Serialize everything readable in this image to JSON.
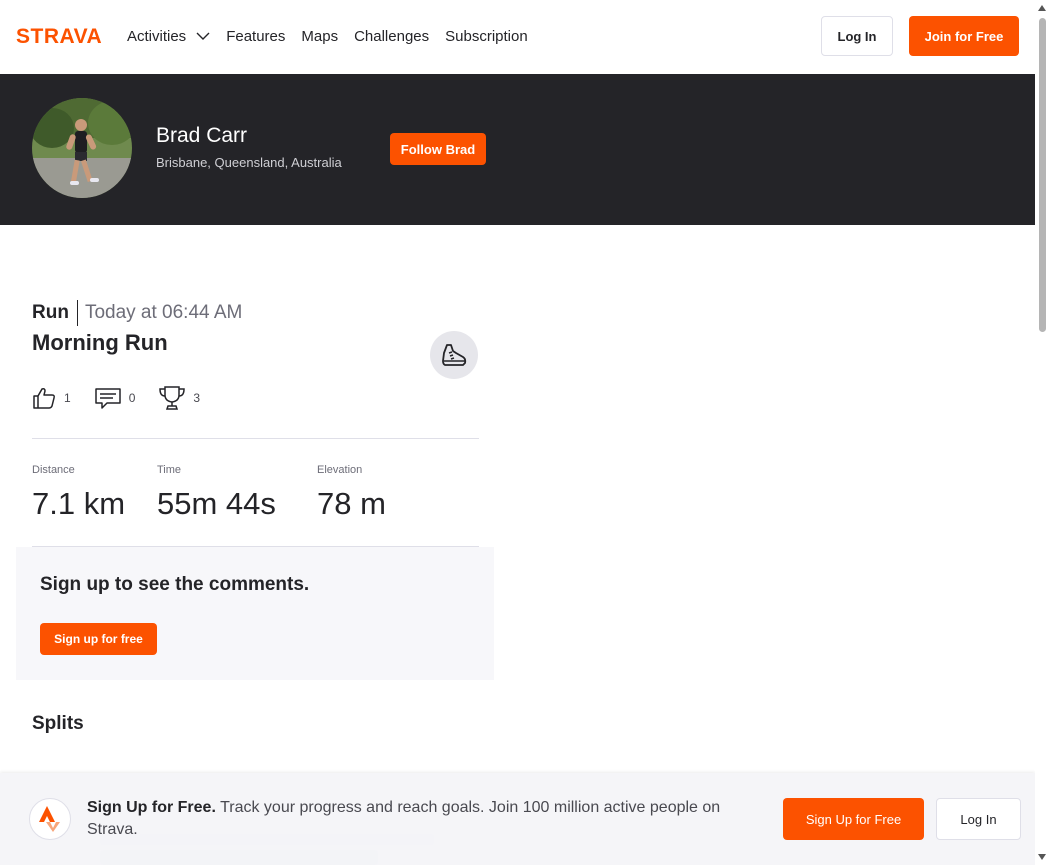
{
  "header": {
    "brand": "STRAVA",
    "nav": [
      {
        "label": "Activities",
        "has_dropdown": true
      },
      {
        "label": "Features"
      },
      {
        "label": "Maps"
      },
      {
        "label": "Challenges"
      },
      {
        "label": "Subscription"
      }
    ],
    "login_label": "Log In",
    "join_label": "Join for Free"
  },
  "athlete": {
    "name": "Brad Carr",
    "location": "Brisbane, Queensland, Australia",
    "follow_label": "Follow Brad"
  },
  "activity": {
    "type": "Run",
    "date": "Today at 06:44 AM",
    "title": "Morning Run",
    "sport_icon": "shoe-icon",
    "kudos_count": "1",
    "comments_count": "0",
    "achievements_count": "3",
    "stats": [
      {
        "label": "Distance",
        "value": "7.1 km"
      },
      {
        "label": "Time",
        "value": "55m 44s"
      },
      {
        "label": "Elevation",
        "value": "78 m"
      }
    ]
  },
  "comments_prompt": {
    "title": "Sign up to see the comments.",
    "button_label": "Sign up for free"
  },
  "splits": {
    "title": "Splits"
  },
  "banner": {
    "headline": "Sign Up for Free.",
    "body": "Track your progress and reach goals. Join 100 million active people on Strava.",
    "signup_label": "Sign Up for Free",
    "login_label": "Log In"
  },
  "colors": {
    "brand": "#fc5200",
    "dark_band": "#242428",
    "text": "#242428",
    "muted": "#6d6d78"
  }
}
